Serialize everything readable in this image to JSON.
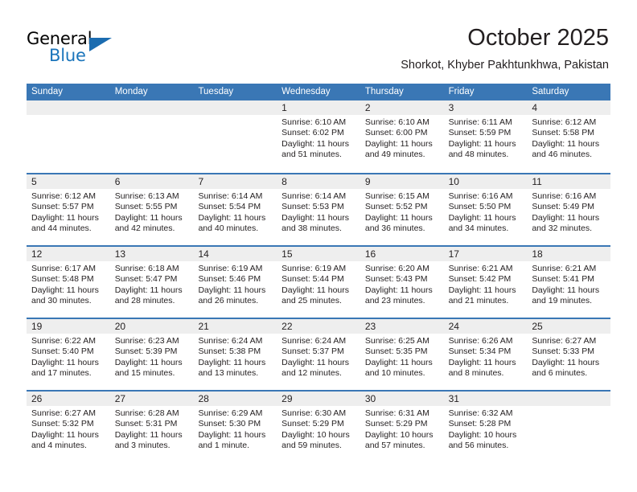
{
  "brand": {
    "name_top": "General",
    "name_bottom": "Blue",
    "accent_color": "#1b75bb",
    "triangle_color": "#1b6cb0"
  },
  "header": {
    "month_title": "October 2025",
    "location": "Shorkot, Khyber Pakhtunkhwa, Pakistan"
  },
  "calendar": {
    "header_color": "#3a77b5",
    "day_band_color": "#eeeeee",
    "weekdays": [
      "Sunday",
      "Monday",
      "Tuesday",
      "Wednesday",
      "Thursday",
      "Friday",
      "Saturday"
    ],
    "weeks": [
      [
        {
          "date": "",
          "sunrise": "",
          "sunset": "",
          "daylight_line1": "",
          "daylight_line2": ""
        },
        {
          "date": "",
          "sunrise": "",
          "sunset": "",
          "daylight_line1": "",
          "daylight_line2": ""
        },
        {
          "date": "",
          "sunrise": "",
          "sunset": "",
          "daylight_line1": "",
          "daylight_line2": ""
        },
        {
          "date": "1",
          "sunrise": "Sunrise: 6:10 AM",
          "sunset": "Sunset: 6:02 PM",
          "daylight_line1": "Daylight: 11 hours",
          "daylight_line2": "and 51 minutes."
        },
        {
          "date": "2",
          "sunrise": "Sunrise: 6:10 AM",
          "sunset": "Sunset: 6:00 PM",
          "daylight_line1": "Daylight: 11 hours",
          "daylight_line2": "and 49 minutes."
        },
        {
          "date": "3",
          "sunrise": "Sunrise: 6:11 AM",
          "sunset": "Sunset: 5:59 PM",
          "daylight_line1": "Daylight: 11 hours",
          "daylight_line2": "and 48 minutes."
        },
        {
          "date": "4",
          "sunrise": "Sunrise: 6:12 AM",
          "sunset": "Sunset: 5:58 PM",
          "daylight_line1": "Daylight: 11 hours",
          "daylight_line2": "and 46 minutes."
        }
      ],
      [
        {
          "date": "5",
          "sunrise": "Sunrise: 6:12 AM",
          "sunset": "Sunset: 5:57 PM",
          "daylight_line1": "Daylight: 11 hours",
          "daylight_line2": "and 44 minutes."
        },
        {
          "date": "6",
          "sunrise": "Sunrise: 6:13 AM",
          "sunset": "Sunset: 5:55 PM",
          "daylight_line1": "Daylight: 11 hours",
          "daylight_line2": "and 42 minutes."
        },
        {
          "date": "7",
          "sunrise": "Sunrise: 6:14 AM",
          "sunset": "Sunset: 5:54 PM",
          "daylight_line1": "Daylight: 11 hours",
          "daylight_line2": "and 40 minutes."
        },
        {
          "date": "8",
          "sunrise": "Sunrise: 6:14 AM",
          "sunset": "Sunset: 5:53 PM",
          "daylight_line1": "Daylight: 11 hours",
          "daylight_line2": "and 38 minutes."
        },
        {
          "date": "9",
          "sunrise": "Sunrise: 6:15 AM",
          "sunset": "Sunset: 5:52 PM",
          "daylight_line1": "Daylight: 11 hours",
          "daylight_line2": "and 36 minutes."
        },
        {
          "date": "10",
          "sunrise": "Sunrise: 6:16 AM",
          "sunset": "Sunset: 5:50 PM",
          "daylight_line1": "Daylight: 11 hours",
          "daylight_line2": "and 34 minutes."
        },
        {
          "date": "11",
          "sunrise": "Sunrise: 6:16 AM",
          "sunset": "Sunset: 5:49 PM",
          "daylight_line1": "Daylight: 11 hours",
          "daylight_line2": "and 32 minutes."
        }
      ],
      [
        {
          "date": "12",
          "sunrise": "Sunrise: 6:17 AM",
          "sunset": "Sunset: 5:48 PM",
          "daylight_line1": "Daylight: 11 hours",
          "daylight_line2": "and 30 minutes."
        },
        {
          "date": "13",
          "sunrise": "Sunrise: 6:18 AM",
          "sunset": "Sunset: 5:47 PM",
          "daylight_line1": "Daylight: 11 hours",
          "daylight_line2": "and 28 minutes."
        },
        {
          "date": "14",
          "sunrise": "Sunrise: 6:19 AM",
          "sunset": "Sunset: 5:46 PM",
          "daylight_line1": "Daylight: 11 hours",
          "daylight_line2": "and 26 minutes."
        },
        {
          "date": "15",
          "sunrise": "Sunrise: 6:19 AM",
          "sunset": "Sunset: 5:44 PM",
          "daylight_line1": "Daylight: 11 hours",
          "daylight_line2": "and 25 minutes."
        },
        {
          "date": "16",
          "sunrise": "Sunrise: 6:20 AM",
          "sunset": "Sunset: 5:43 PM",
          "daylight_line1": "Daylight: 11 hours",
          "daylight_line2": "and 23 minutes."
        },
        {
          "date": "17",
          "sunrise": "Sunrise: 6:21 AM",
          "sunset": "Sunset: 5:42 PM",
          "daylight_line1": "Daylight: 11 hours",
          "daylight_line2": "and 21 minutes."
        },
        {
          "date": "18",
          "sunrise": "Sunrise: 6:21 AM",
          "sunset": "Sunset: 5:41 PM",
          "daylight_line1": "Daylight: 11 hours",
          "daylight_line2": "and 19 minutes."
        }
      ],
      [
        {
          "date": "19",
          "sunrise": "Sunrise: 6:22 AM",
          "sunset": "Sunset: 5:40 PM",
          "daylight_line1": "Daylight: 11 hours",
          "daylight_line2": "and 17 minutes."
        },
        {
          "date": "20",
          "sunrise": "Sunrise: 6:23 AM",
          "sunset": "Sunset: 5:39 PM",
          "daylight_line1": "Daylight: 11 hours",
          "daylight_line2": "and 15 minutes."
        },
        {
          "date": "21",
          "sunrise": "Sunrise: 6:24 AM",
          "sunset": "Sunset: 5:38 PM",
          "daylight_line1": "Daylight: 11 hours",
          "daylight_line2": "and 13 minutes."
        },
        {
          "date": "22",
          "sunrise": "Sunrise: 6:24 AM",
          "sunset": "Sunset: 5:37 PM",
          "daylight_line1": "Daylight: 11 hours",
          "daylight_line2": "and 12 minutes."
        },
        {
          "date": "23",
          "sunrise": "Sunrise: 6:25 AM",
          "sunset": "Sunset: 5:35 PM",
          "daylight_line1": "Daylight: 11 hours",
          "daylight_line2": "and 10 minutes."
        },
        {
          "date": "24",
          "sunrise": "Sunrise: 6:26 AM",
          "sunset": "Sunset: 5:34 PM",
          "daylight_line1": "Daylight: 11 hours",
          "daylight_line2": "and 8 minutes."
        },
        {
          "date": "25",
          "sunrise": "Sunrise: 6:27 AM",
          "sunset": "Sunset: 5:33 PM",
          "daylight_line1": "Daylight: 11 hours",
          "daylight_line2": "and 6 minutes."
        }
      ],
      [
        {
          "date": "26",
          "sunrise": "Sunrise: 6:27 AM",
          "sunset": "Sunset: 5:32 PM",
          "daylight_line1": "Daylight: 11 hours",
          "daylight_line2": "and 4 minutes."
        },
        {
          "date": "27",
          "sunrise": "Sunrise: 6:28 AM",
          "sunset": "Sunset: 5:31 PM",
          "daylight_line1": "Daylight: 11 hours",
          "daylight_line2": "and 3 minutes."
        },
        {
          "date": "28",
          "sunrise": "Sunrise: 6:29 AM",
          "sunset": "Sunset: 5:30 PM",
          "daylight_line1": "Daylight: 11 hours",
          "daylight_line2": "and 1 minute."
        },
        {
          "date": "29",
          "sunrise": "Sunrise: 6:30 AM",
          "sunset": "Sunset: 5:29 PM",
          "daylight_line1": "Daylight: 10 hours",
          "daylight_line2": "and 59 minutes."
        },
        {
          "date": "30",
          "sunrise": "Sunrise: 6:31 AM",
          "sunset": "Sunset: 5:29 PM",
          "daylight_line1": "Daylight: 10 hours",
          "daylight_line2": "and 57 minutes."
        },
        {
          "date": "31",
          "sunrise": "Sunrise: 6:32 AM",
          "sunset": "Sunset: 5:28 PM",
          "daylight_line1": "Daylight: 10 hours",
          "daylight_line2": "and 56 minutes."
        },
        {
          "date": "",
          "sunrise": "",
          "sunset": "",
          "daylight_line1": "",
          "daylight_line2": ""
        }
      ]
    ]
  }
}
